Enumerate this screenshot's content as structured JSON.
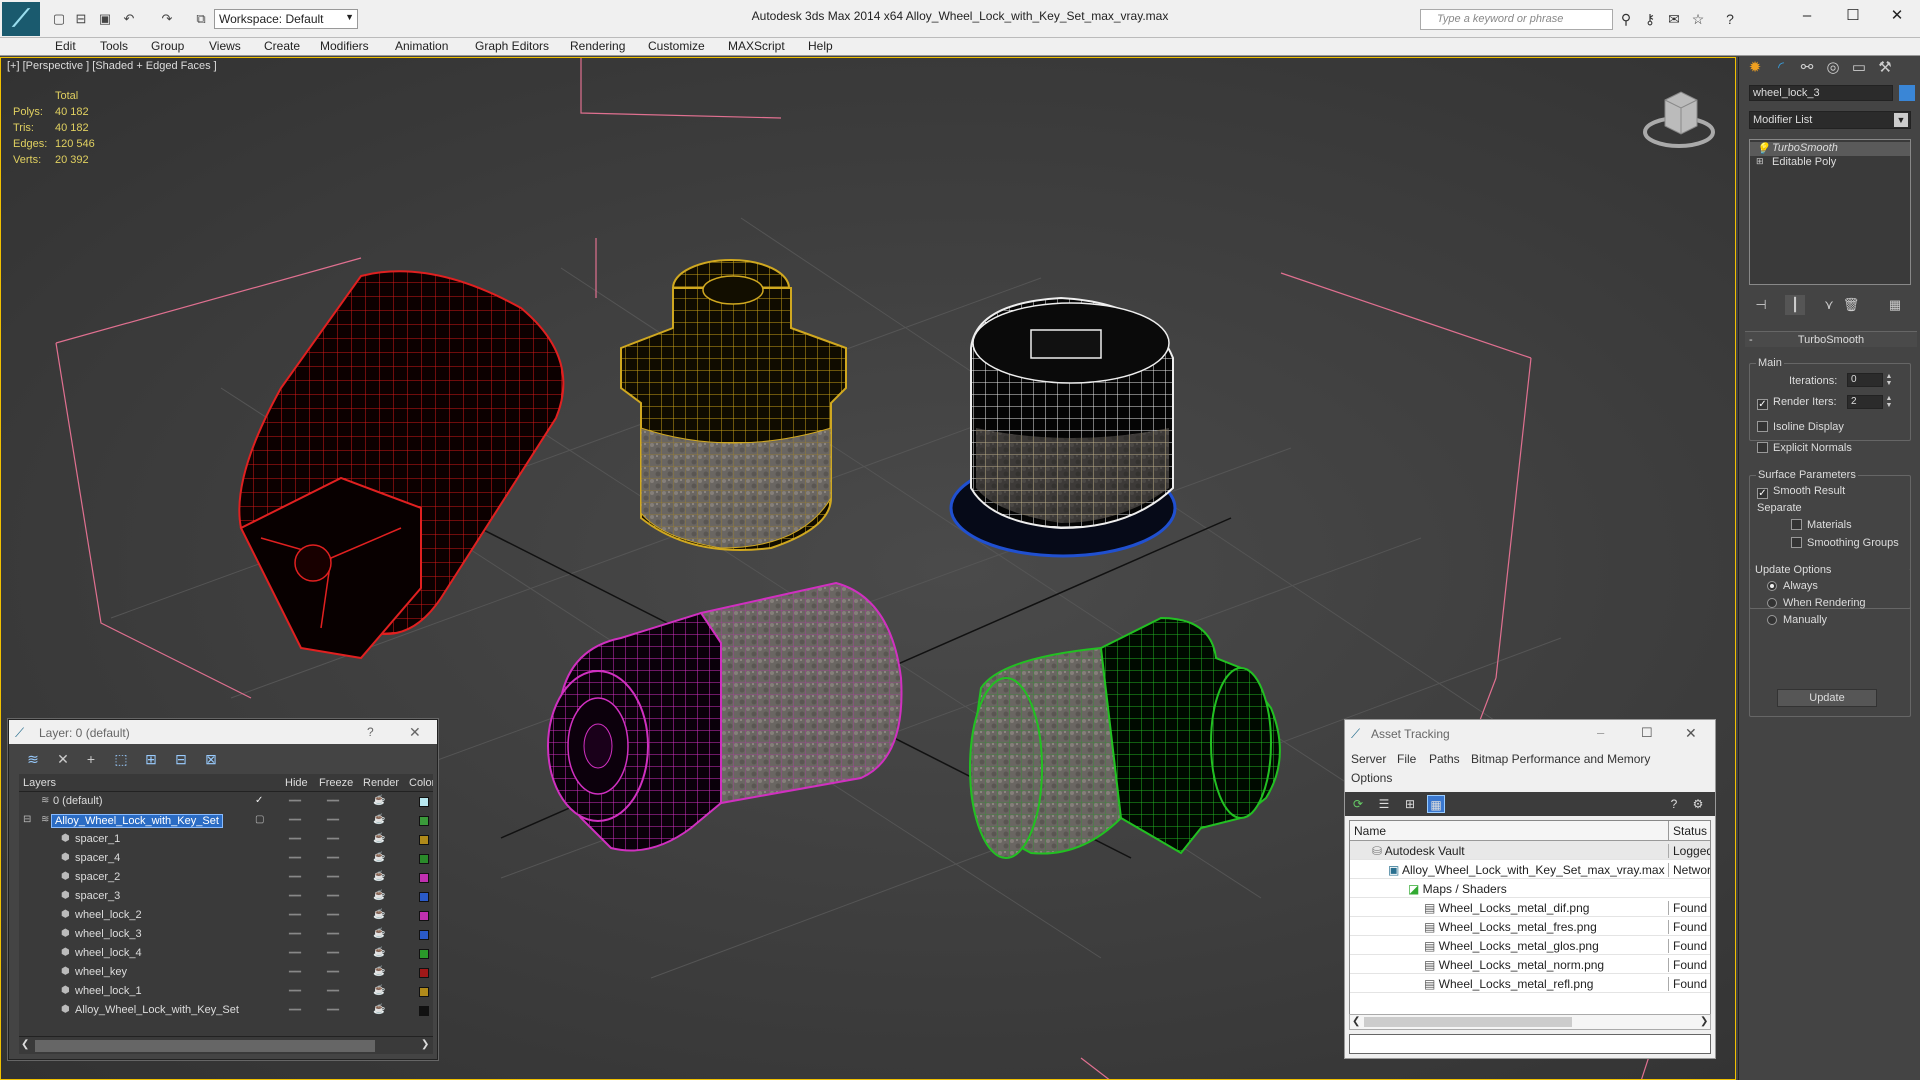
{
  "app": {
    "title": "Autodesk 3ds Max  2014 x64      Alloy_Wheel_Lock_with_Key_Set_max_vray.max",
    "workspace": "Workspace: Default",
    "search_placeholder": "Type a keyword or phrase"
  },
  "menu": [
    "Edit",
    "Tools",
    "Group",
    "Views",
    "Create",
    "Modifiers",
    "Animation",
    "Graph Editors",
    "Rendering",
    "Customize",
    "MAXScript",
    "Help"
  ],
  "viewport": {
    "label": "[+] [Perspective ] [Shaded + Edged Faces ]",
    "stats": {
      "header": "Total",
      "rows": [
        {
          "label": "Polys:",
          "value": "40 182"
        },
        {
          "label": "Tris:",
          "value": "40 182"
        },
        {
          "label": "Edges:",
          "value": "120 546"
        },
        {
          "label": "Verts:",
          "value": "20 392"
        }
      ]
    }
  },
  "command_panel": {
    "object_name": "wheel_lock_3",
    "object_color": "#3a86d6",
    "modifier_list": "Modifier List",
    "stack": [
      "TurboSmooth",
      "Editable Poly"
    ],
    "rollout_title": "TurboSmooth",
    "main_group": "Main",
    "iterations_label": "Iterations:",
    "iterations_value": "0",
    "render_iters_label": "Render Iters:",
    "render_iters_value": "2",
    "isoline_label": "Isoline Display",
    "explicit_normals_label": "Explicit Normals",
    "surface_group": "Surface Parameters",
    "smooth_result_label": "Smooth Result",
    "separate_label": "Separate",
    "materials_label": "Materials",
    "smoothing_groups_label": "Smoothing Groups",
    "update_group": "Update Options",
    "always_label": "Always",
    "when_rendering_label": "When Rendering",
    "manually_label": "Manually",
    "update_button": "Update"
  },
  "layer_window": {
    "title": "Layer: 0 (default)",
    "help": "?",
    "columns": [
      "Layers",
      "Hide",
      "Freeze",
      "Render",
      "Color"
    ],
    "rows": [
      {
        "name": "0 (default)",
        "color": "#b8e8f0",
        "checked": "✓"
      },
      {
        "name": "Alloy_Wheel_Lock_with_Key_Set",
        "color": "#3a9a3a"
      },
      {
        "name": "spacer_1",
        "color": "#b08a1a"
      },
      {
        "name": "spacer_4",
        "color": "#2a8a2a"
      },
      {
        "name": "spacer_2",
        "color": "#c030b0"
      },
      {
        "name": "spacer_3",
        "color": "#2a5ac8"
      },
      {
        "name": "wheel_lock_2",
        "color": "#c030b0"
      },
      {
        "name": "wheel_lock_3",
        "color": "#2a5ac8"
      },
      {
        "name": "wheel_lock_4",
        "color": "#2a9a2a"
      },
      {
        "name": "wheel_key",
        "color": "#a01818"
      },
      {
        "name": "wheel_lock_1",
        "color": "#b08a1a"
      },
      {
        "name": "Alloy_Wheel_Lock_with_Key_Set",
        "color": "#111111"
      }
    ]
  },
  "asset_window": {
    "title": "Asset Tracking",
    "menu": [
      "Server",
      "File",
      "Paths",
      "Bitmap Performance and Memory",
      "Options"
    ],
    "columns": [
      "Name",
      "Status"
    ],
    "rows": [
      {
        "name": "Autodesk Vault",
        "status": "Logged",
        "indent": 0
      },
      {
        "name": "Alloy_Wheel_Lock_with_Key_Set_max_vray.max",
        "status": "Network",
        "indent": 1
      },
      {
        "name": "Maps / Shaders",
        "status": "",
        "indent": 2
      },
      {
        "name": "Wheel_Locks_metal_dif.png",
        "status": "Found",
        "indent": 3
      },
      {
        "name": "Wheel_Locks_metal_fres.png",
        "status": "Found",
        "indent": 3
      },
      {
        "name": "Wheel_Locks_metal_glos.png",
        "status": "Found",
        "indent": 3
      },
      {
        "name": "Wheel_Locks_metal_norm.png",
        "status": "Found",
        "indent": 3
      },
      {
        "name": "Wheel_Locks_metal_refl.png",
        "status": "Found",
        "indent": 3
      }
    ]
  }
}
